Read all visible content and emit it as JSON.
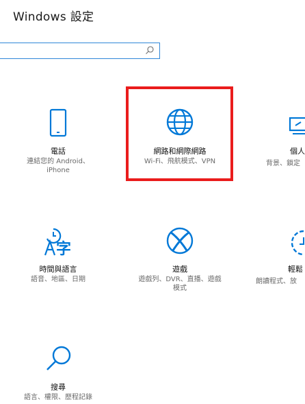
{
  "window": {
    "title": "Windows 設定"
  },
  "search": {
    "placeholder": ""
  },
  "tiles": {
    "phone": {
      "label": "電話",
      "desc_line1": "連結您的 Android、",
      "desc_line2": "iPhone"
    },
    "network": {
      "label": "網路和網際網路",
      "desc_line1": "Wi-Fi、飛航模式、VPN"
    },
    "personalization_partial": {
      "label": "個人",
      "desc_line1": "背景、鎖定"
    },
    "time_language": {
      "label": "時間與語言",
      "desc_line1": "語音、地區、日期"
    },
    "gaming": {
      "label": "遊戲",
      "desc_line1": "遊戲列、DVR、直播、遊戲",
      "desc_line2": "模式"
    },
    "ease_of_access_partial": {
      "label": "輕鬆",
      "desc_line1": "朗讀程式、放"
    },
    "search_tile": {
      "label": "搜尋",
      "desc_line1": "語言、權限、歷程記錄"
    }
  },
  "colors": {
    "accent": "#0078d7",
    "highlight": "#ea1c1c",
    "text": "#111111",
    "subtext": "#6a6a6a"
  },
  "icons": {
    "phone": "phone-icon",
    "network": "globe-icon",
    "personalization": "paint-icon",
    "time_language": "time-language-icon",
    "gaming": "xbox-icon",
    "ease_of_access": "ease-of-access-icon",
    "search": "magnifier-icon"
  }
}
